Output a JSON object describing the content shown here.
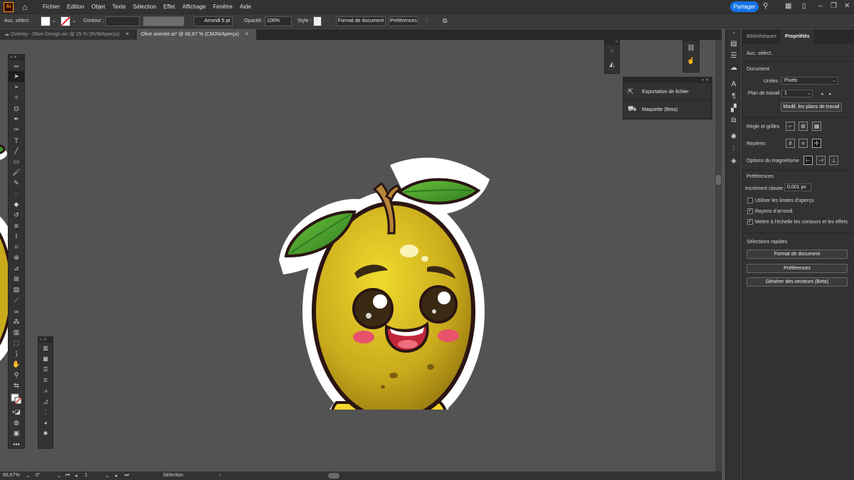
{
  "app": {
    "logo": "Ai"
  },
  "menu": [
    "Fichier",
    "Edition",
    "Objet",
    "Texte",
    "Sélection",
    "Effet",
    "Affichage",
    "Fenêtre",
    "Aide"
  ],
  "share_label": "Partager",
  "control": {
    "selection_label": "Auc. sélect.",
    "contour_label": "Contour :",
    "brush_label": "Arrondi 5 pt",
    "opacity_label": "Opacité :",
    "opacity_value": "100%",
    "style_label": "Style :",
    "doc_format_btn": "Format de document",
    "preferences_btn": "Préférences"
  },
  "tabs": [
    {
      "label": "Overlay - Olive Design.aic @ 25 % (RVB/Aperçu)",
      "active": false
    },
    {
      "label": "Olive animée.ai* @ 66,67 % (CMJN/Aperçu)",
      "active": true
    }
  ],
  "export_panel": {
    "items": [
      "Exportation de fichier",
      "Maquette (Beta)"
    ]
  },
  "status": {
    "zoom": "66,67%",
    "rotation": "0°",
    "artboard": "1",
    "tool": "Sélection"
  },
  "props": {
    "tabs": [
      "Bibliothèques",
      "Propriétés"
    ],
    "no_selection": "Auc. sélect.",
    "document_title": "Document",
    "units_label": "Unités :",
    "units_value": "Pixels",
    "artboard_label": "Plan de travail :",
    "artboard_value": "1",
    "edit_artboards_btn": "Modif. les plans de travail",
    "rulers_label": "Règle et grilles",
    "guides_label": "Repères",
    "snap_label": "Options du magnétisme",
    "preferences_title": "Préférences",
    "key_increment_label": "Incrément clavier :",
    "key_increment_value": "0,001 px",
    "checkboxes": [
      {
        "label": "Utiliser les limites d'aperçu",
        "checked": false
      },
      {
        "label": "Rayons d'arrondi",
        "checked": true
      },
      {
        "label": "Mettre à l'échelle les contours et les effets",
        "checked": true
      }
    ],
    "quick_actions_title": "Sélections rapides",
    "quick_buttons": [
      "Format de document",
      "Préférences",
      "Générer des vecteurs (Beta)"
    ]
  },
  "colors": {
    "accent": "#1473e6",
    "olive": "#c9aa1c",
    "leaf": "#3b9a2e",
    "stem": "#b88538",
    "outline": "#2a1512",
    "cheek": "#e8536b"
  }
}
